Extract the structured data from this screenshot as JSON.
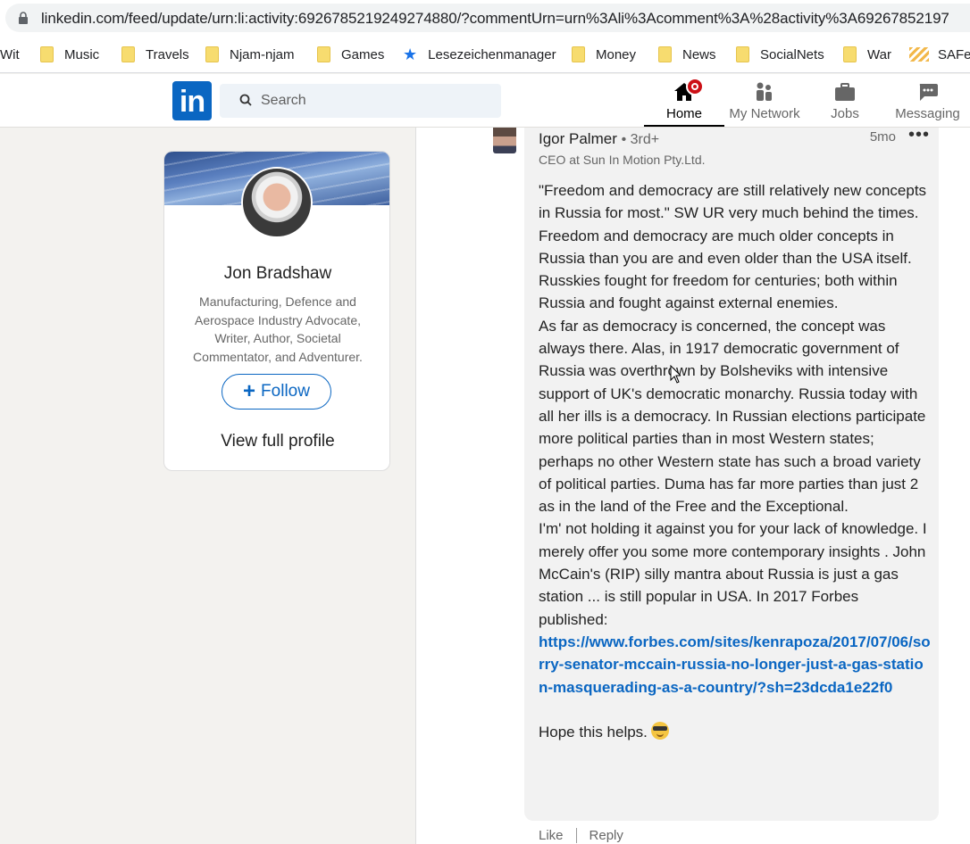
{
  "browser": {
    "url": "linkedin.com/feed/update/urn:li:activity:6926785219249274880/?commentUrn=urn%3Ali%3Acomment%3A%28activity%3A69267852197",
    "bookmarks": [
      "Wit",
      "Music",
      "Travels",
      "Njam-njam",
      "Games",
      "Lesezeichenmanager",
      "Money",
      "News",
      "SocialNets",
      "War",
      "SAFe"
    ]
  },
  "header": {
    "logo": "in",
    "search_placeholder": "Search",
    "nav": {
      "home": "Home",
      "network": "My Network",
      "jobs": "Jobs",
      "messaging": "Messaging"
    }
  },
  "profile_card": {
    "name": "Jon Bradshaw",
    "headline": "Manufacturing, Defence and Aerospace Industry Advocate, Writer, Author, Societal Commentator, and Adventurer.",
    "follow_label": "Follow",
    "view_profile": "View full profile"
  },
  "comment": {
    "author": "Igor Palmer",
    "degree": "• 3rd+",
    "time": "5mo",
    "more": "•••",
    "author_headline": "CEO at Sun In Motion Pty.Ltd.",
    "paragraphs": [
      "\"Freedom and democracy are still relatively new concepts in Russia for most.\" SW UR very much behind the times. Freedom and democracy are much older concepts in Russia than you are and even older than the USA itself. Russkies fought for freedom for centuries; both within Russia and fought against external enemies.",
      "As far as democracy is concerned, the concept was always there. Alas, in 1917 democratic government of Russia was overthrown by Bolsheviks with intensive support of UK's democratic monarchy. Russia today with all her ills is a democracy. In Russian elections participate more political parties than in most Western states; perhaps no other Western state has such a broad variety of political parties. Duma has far more parties than just 2 as in the land of the Free and the Exceptional.",
      "I'm' not holding it against you for your lack of knowledge. I merely offer you some more contemporary insights . John McCain's (RIP) silly mantra about Russia is just a gas station ... is still popular in USA. In 2017 Forbes published:"
    ],
    "link": "https://www.forbes.com/sites/kenrapoza/2017/07/06/sorry-senator-mccain-russia-no-longer-just-a-gas-station-masquerading-as-a-country/?sh=23dcda1e22f0",
    "closing": "Hope this helps.",
    "like_label": "Like",
    "reply_label": "Reply"
  }
}
